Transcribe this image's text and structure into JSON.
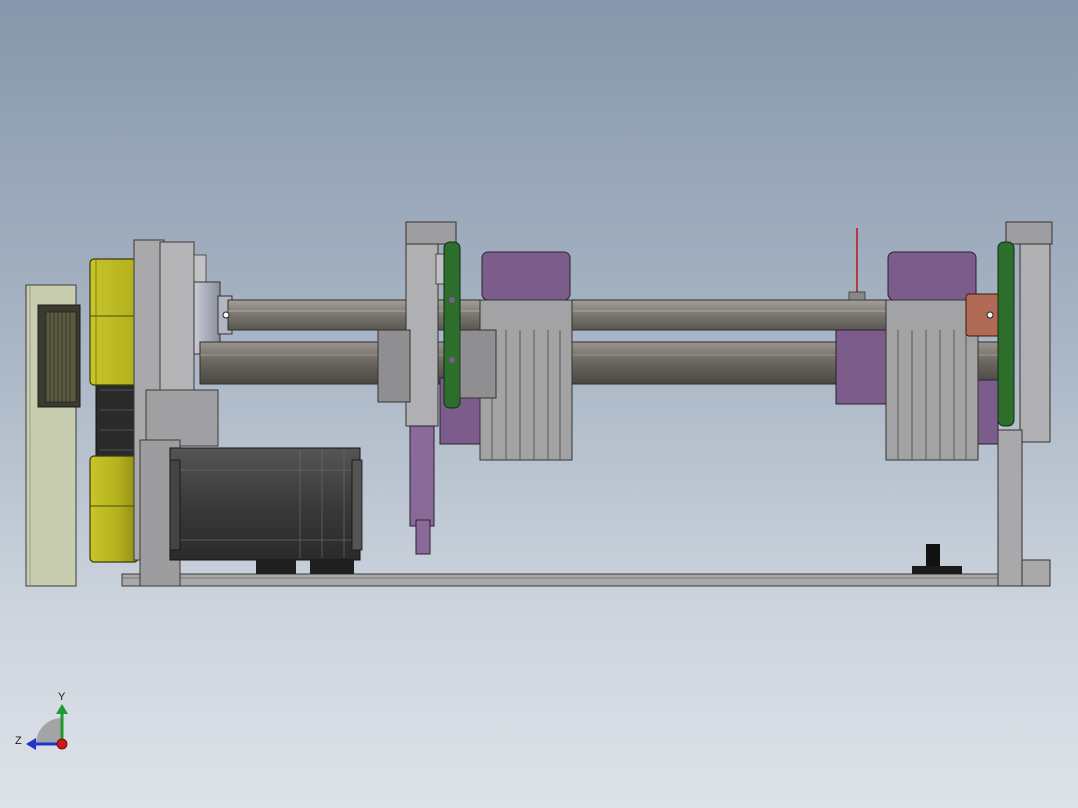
{
  "view": {
    "background_top": "#8797ab",
    "background_bottom": "#dde2e8"
  },
  "triad": {
    "y_label": "Y",
    "z_label": "Z",
    "y_axis_color": "#1f9a2e",
    "z_axis_color": "#2233cc",
    "x_axis_color": "#d01818"
  },
  "colors": {
    "frame_gray": "#a9a9ab",
    "shaft_gray": "#6e6a64",
    "rod_gray": "#8a8680",
    "yellow_housing": "#b7b420",
    "motor_dark": "#3c3c3c",
    "purple_plate": "#7c5c8a",
    "green_pulley": "#2d6e2d",
    "copper_collar": "#b06a55",
    "light_panel": "#c9cdb0",
    "indicator_red": "#b01818"
  }
}
